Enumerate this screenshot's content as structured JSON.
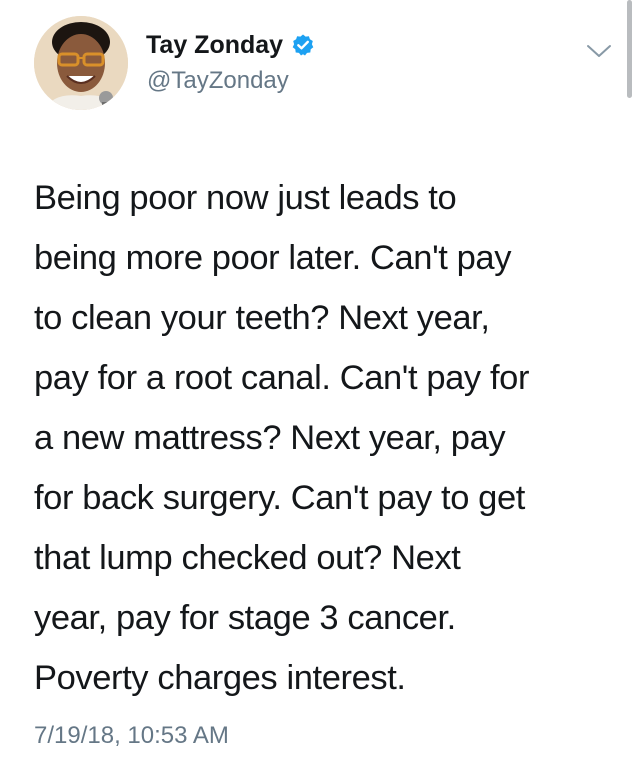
{
  "user": {
    "display_name": "Tay Zonday",
    "handle": "@TayZonday",
    "verified": true,
    "verified_color": "#1da1f2"
  },
  "tweet": {
    "lines": [
      "Being poor now just leads to",
      "being more poor later. Can't pay",
      "to clean your teeth? Next year,",
      "pay for a root canal. Can't pay for",
      "a new mattress? Next year, pay",
      "for back surgery. Can't pay to get",
      "that lump checked out? Next",
      "year, pay for stage 3 cancer.",
      "Poverty charges interest."
    ],
    "timestamp": "7/19/18, 10:53 AM"
  },
  "icons": {
    "avatar": "profile-photo",
    "verified": "verified-badge-icon",
    "menu": "chevron-down-icon"
  },
  "colors": {
    "text": "#14171a",
    "secondary": "#657786",
    "background": "#ffffff"
  }
}
